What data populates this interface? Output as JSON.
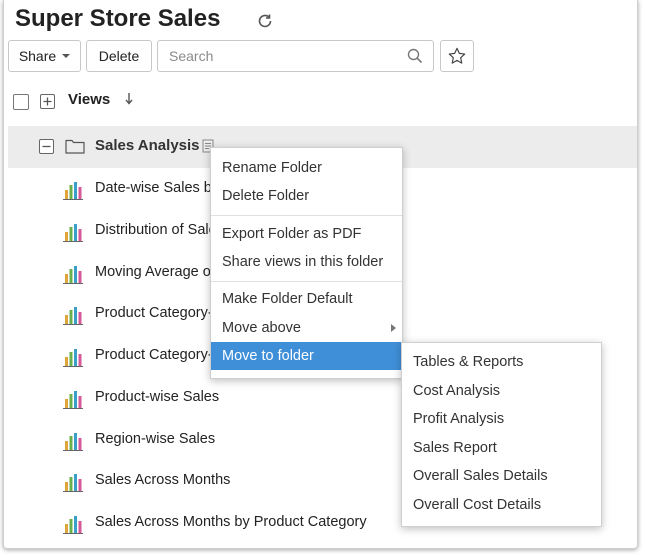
{
  "header": {
    "title": "Super Store Sales"
  },
  "toolbar": {
    "share_label": "Share",
    "delete_label": "Delete",
    "search_placeholder": "Search"
  },
  "views_header": {
    "label": "Views"
  },
  "folder": {
    "name": "Sales Analysis"
  },
  "views": [
    "Date-wise Sales by",
    "Distribution of Sale",
    "Moving Average o",
    "Product Category-",
    "Product Category-",
    "Product-wise Sales",
    "Region-wise Sales",
    "Sales Across Months",
    "Sales Across Months by Product Category"
  ],
  "context_menu": {
    "items": [
      "Rename Folder",
      "Delete Folder",
      "Export Folder as PDF",
      "Share views in this folder",
      "Make Folder Default",
      "Move above",
      "Move to folder"
    ],
    "active_index": 6
  },
  "submenu": {
    "items": [
      "Tables & Reports",
      "Cost Analysis",
      "Profit Analysis",
      "Sales Report",
      "Overall Sales Details",
      "Overall Cost Details"
    ]
  },
  "colors": {
    "accent": "#3f8fd8",
    "folder_row_bg": "#ececec"
  },
  "icons": [
    "refresh-icon",
    "search-icon",
    "star-icon",
    "sort-icon",
    "folder-icon",
    "note-icon",
    "bar-chart-icon"
  ]
}
